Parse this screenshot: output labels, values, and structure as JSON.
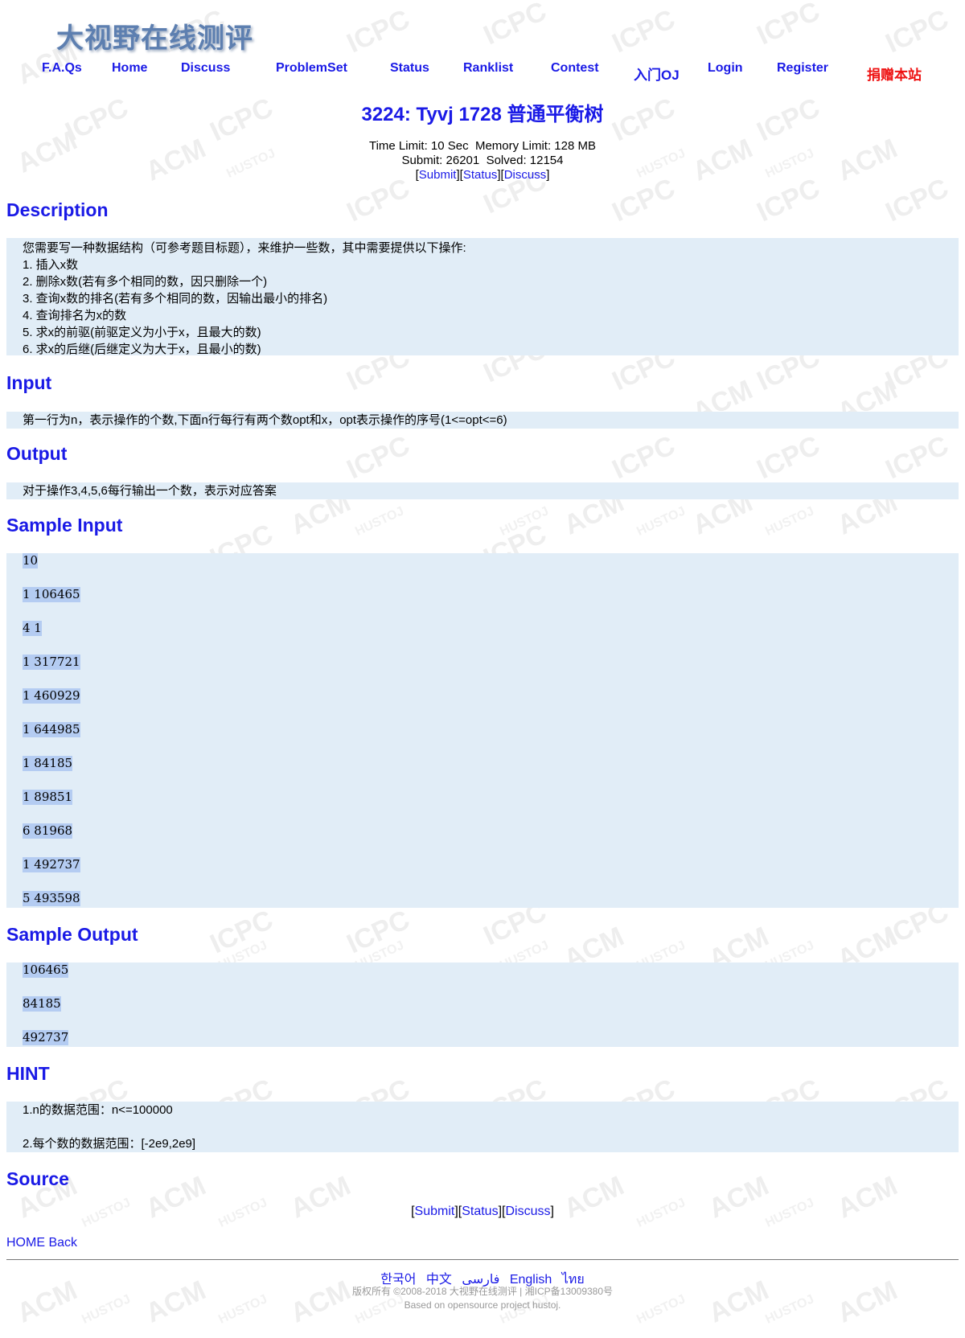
{
  "header": {
    "logo_text": "大视野在线测评",
    "nav": [
      {
        "label": "F.A.Qs"
      },
      {
        "label": "Home"
      },
      {
        "label": "Discuss"
      },
      {
        "label": "ProblemSet"
      },
      {
        "label": "Status"
      },
      {
        "label": "Ranklist"
      },
      {
        "label": "Contest"
      },
      {
        "label": "入门OJ"
      },
      {
        "label": "Login"
      },
      {
        "label": "Register"
      },
      {
        "label": "捐赠本站"
      }
    ]
  },
  "problem": {
    "title": "3224: Tyvj 1728 普通平衡树",
    "time_limit": "Time Limit: 10 Sec",
    "memory_limit": "Memory Limit: 128 MB",
    "submit_count": "Submit: 26201",
    "solved_count": "Solved: 12154",
    "links": {
      "submit": "Submit",
      "status": "Status",
      "discuss": "Discuss"
    }
  },
  "sections": {
    "description": {
      "heading": "Description",
      "lines": [
        "您需要写一种数据结构（可参考题目标题），来维护一些数，其中需要提供以下操作:",
        "1. 插入x数",
        "2. 删除x数(若有多个相同的数，因只删除一个)",
        "3. 查询x数的排名(若有多个相同的数，因输出最小的排名)",
        "4. 查询排名为x的数",
        "5. 求x的前驱(前驱定义为小于x，且最大的数)",
        "6. 求x的后继(后继定义为大于x，且最小的数)"
      ]
    },
    "input": {
      "heading": "Input",
      "text": "第一行为n，表示操作的个数,下面n行每行有两个数opt和x，opt表示操作的序号(1<=opt<=6)"
    },
    "output": {
      "heading": "Output",
      "text": "对于操作3,4,5,6每行输出一个数，表示对应答案"
    },
    "sample_input": {
      "heading": "Sample Input",
      "lines": [
        "10",
        "1 106465",
        "4 1",
        "1 317721",
        "1 460929",
        "1 644985",
        "1 84185",
        "1 89851",
        "6 81968",
        "1 492737",
        "5 493598"
      ]
    },
    "sample_output": {
      "heading": "Sample Output",
      "lines": [
        "106465",
        "84185",
        "492737"
      ]
    },
    "hint": {
      "heading": "HINT",
      "lines": [
        "1.n的数据范围：n<=100000",
        "2.每个数的数据范围：[-2e9,2e9]"
      ]
    },
    "source": {
      "heading": "Source"
    }
  },
  "footer": {
    "home_back": "HOME Back",
    "languages": [
      "한국어",
      "中文",
      "فارسی",
      "English",
      "ไทย"
    ],
    "copyright": "版权所有 ©2008-2018 大视野在线测评 | 湘ICP备13009380号",
    "based_on": "Based on opensource project hustoj."
  }
}
